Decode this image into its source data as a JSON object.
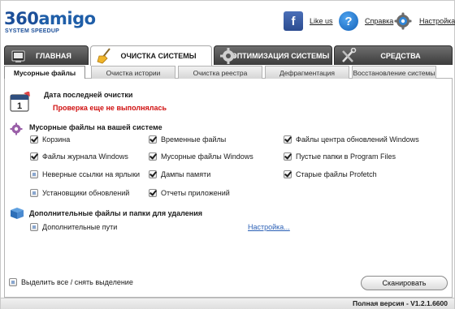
{
  "header": {
    "logo_text_a": "360",
    "logo_text_b": "amigo",
    "logo_sub": "SYSTEM SPEEDUP",
    "like_label": "Like us",
    "help_label": "Справка",
    "settings_label": "Настройка",
    "fb_glyph": "f",
    "help_glyph": "?"
  },
  "main_tabs": [
    {
      "label": "ГЛАВНАЯ",
      "icon": "home-icon"
    },
    {
      "label": "ОЧИСТКА СИСТЕМЫ",
      "icon": "broom-icon"
    },
    {
      "label": "ОПТИМИЗАЦИЯ СИСТЕМЫ",
      "icon": "gear-optimize-icon"
    },
    {
      "label": "СРЕДСТВА",
      "icon": "tools-icon"
    }
  ],
  "sub_tabs": [
    {
      "label": "Мусорные файлы"
    },
    {
      "label": "Очистка истории"
    },
    {
      "label": "Очистка реестра"
    },
    {
      "label": "Дефрагментация"
    },
    {
      "label": "Восстановление системы"
    }
  ],
  "last_clean": {
    "title": "Дата последней очистки",
    "status": "Проверка еще не выполнялась",
    "calendar_day": "1"
  },
  "junk": {
    "title": "Мусорные файлы на вашей системе",
    "items": [
      {
        "label": "Корзина",
        "checked": true
      },
      {
        "label": "Файлы журнала Windows",
        "checked": true
      },
      {
        "label": "Неверные ссылки на ярлыки",
        "checked": false
      },
      {
        "label": "Установщики обновлений",
        "checked": false
      },
      {
        "label": "Временные файлы",
        "checked": true
      },
      {
        "label": "Мусорные файлы Windows",
        "checked": true
      },
      {
        "label": "Дампы памяти",
        "checked": true
      },
      {
        "label": "Отчеты приложений",
        "checked": true
      },
      {
        "label": "Файлы центра обновлений Windows",
        "checked": true
      },
      {
        "label": "Пустые папки в Program Files",
        "checked": true
      },
      {
        "label": "Старые файлы Profetch",
        "checked": true
      }
    ]
  },
  "extra": {
    "title": "Дополнительные файлы и папки для удаления",
    "paths_label": "Дополнительные пути",
    "settings_link": "Настройка..."
  },
  "footer": {
    "select_all_label": "Выделить все / снять выделение",
    "scan_button": "Сканировать"
  },
  "status": {
    "version": "Полная версия  - V1.2.1.6600"
  },
  "colors": {
    "brand": "#1c4f99",
    "warning": "#d01010",
    "link": "#2a5fb5",
    "tab_dark": "#4a4a4a"
  }
}
